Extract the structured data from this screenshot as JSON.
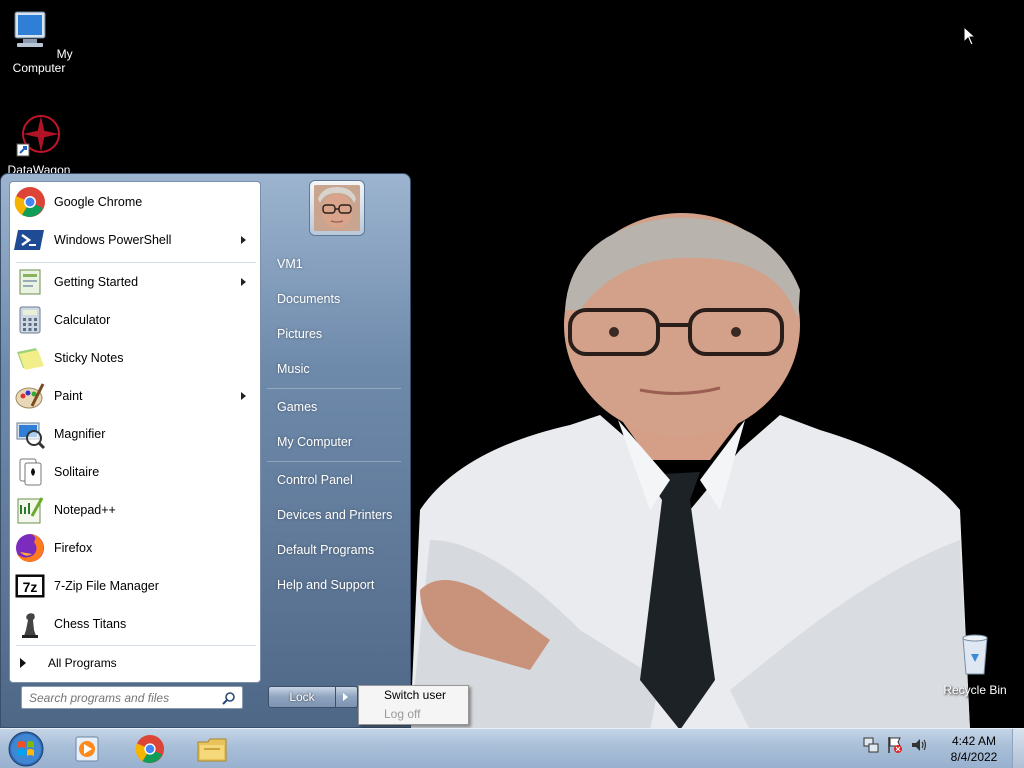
{
  "desktop": {
    "icons": [
      {
        "label": "My Computer",
        "icon": "computer-icon"
      },
      {
        "label": "DataWagon",
        "icon": "datawagon-icon"
      },
      {
        "label": "Recycle Bin",
        "icon": "recycle-bin-icon"
      }
    ]
  },
  "start_menu": {
    "pinned": [
      {
        "label": "Google Chrome",
        "icon": "chrome-icon",
        "submenu": false
      },
      {
        "label": "Windows PowerShell",
        "icon": "powershell-icon",
        "submenu": true
      }
    ],
    "recent": [
      {
        "label": "Getting Started",
        "icon": "getting-started-icon",
        "submenu": true
      },
      {
        "label": "Calculator",
        "icon": "calculator-icon",
        "submenu": false
      },
      {
        "label": "Sticky Notes",
        "icon": "sticky-notes-icon",
        "submenu": false
      },
      {
        "label": "Paint",
        "icon": "paint-icon",
        "submenu": true
      },
      {
        "label": "Magnifier",
        "icon": "magnifier-icon",
        "submenu": false
      },
      {
        "label": "Solitaire",
        "icon": "solitaire-icon",
        "submenu": false
      },
      {
        "label": "Notepad++",
        "icon": "notepadpp-icon",
        "submenu": false
      },
      {
        "label": "Firefox",
        "icon": "firefox-icon",
        "submenu": false
      },
      {
        "label": "7-Zip File Manager",
        "icon": "7zip-icon",
        "submenu": false
      },
      {
        "label": "Chess Titans",
        "icon": "chess-icon",
        "submenu": false
      }
    ],
    "all_programs": "All Programs",
    "search_placeholder": "Search programs and files",
    "places": [
      {
        "label": "VM1"
      },
      {
        "label": "Documents"
      },
      {
        "label": "Pictures"
      },
      {
        "label": "Music"
      },
      {
        "label": "Games"
      },
      {
        "label": "My Computer"
      },
      {
        "label": "Control Panel"
      },
      {
        "label": "Devices and Printers"
      },
      {
        "label": "Default Programs"
      },
      {
        "label": "Help and Support"
      }
    ],
    "lock_label": "Lock",
    "power_menu": {
      "switch_user": "Switch user",
      "log_off": "Log off"
    }
  },
  "taskbar": {
    "pinned_icons": [
      "media-player-icon",
      "chrome-icon",
      "explorer-icon"
    ],
    "tray_icons": [
      "network-icon",
      "action-center-flag-icon",
      "volume-icon"
    ],
    "clock": {
      "time": "4:42 AM",
      "date": "8/4/2022"
    }
  },
  "colors": {
    "taskbar": "#a9bfd8",
    "start_menu_pane": "#6e8aab",
    "desktop_background": "#000000"
  }
}
